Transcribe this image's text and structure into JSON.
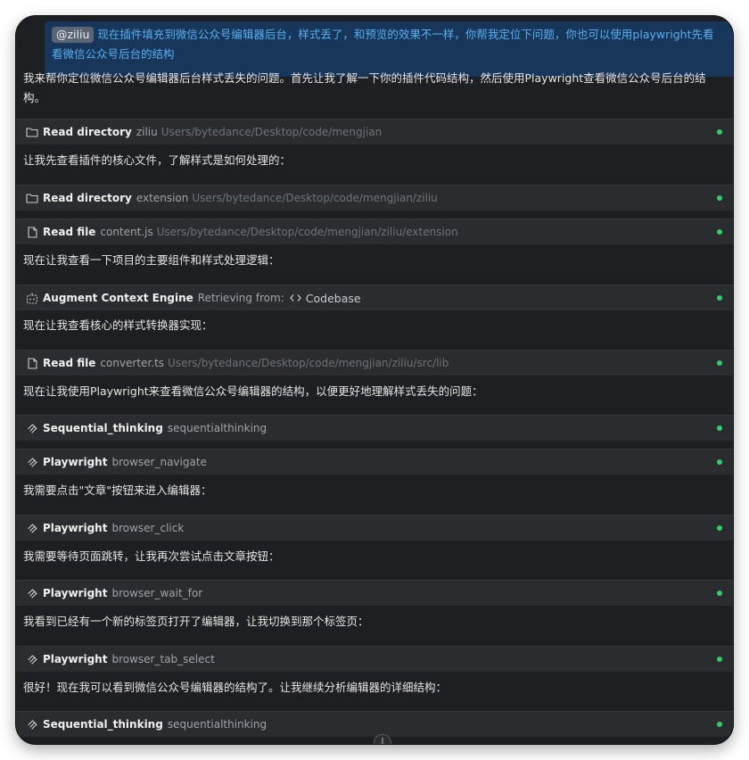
{
  "user_message": {
    "mention": "@ziliu",
    "text": "现在插件填充到微信公众号编辑器后台，样式丢了，和预览的效果不一样，你帮我定位下问题，你也可以使用playwright先看看微信公众号后台的结构"
  },
  "messages": [
    "我来帮你定位微信公众号编辑器后台样式丢失的问题。首先让我了解一下你的插件代码结构，然后使用Playwright查看微信公众号后台的结构。",
    "让我先查看插件的核心文件，了解样式是如何处理的：",
    "现在让我查看一下项目的主要组件和样式处理逻辑：",
    "现在让我查看核心的样式转换器实现：",
    "现在让我使用Playwright来查看微信公众号编辑器的结构，以便更好地理解样式丢失的问题：",
    "我需要点击\"文章\"按钮来进入编辑器：",
    "我需要等待页面跳转，让我再次尝试点击文章按钮：",
    "我看到已经有一个新的标签页打开了编辑器，让我切换到那个标签页：",
    "很好！现在我可以看到微信公众号编辑器的结构了。让我继续分析编辑器的详细结构："
  ],
  "tools": [
    {
      "icon": "folder-icon",
      "name": "Read directory",
      "arg": "ziliu",
      "path": "Users/bytedance/Desktop/code/mengjian"
    },
    {
      "icon": "folder-icon",
      "name": "Read directory",
      "arg": "extension",
      "path": "Users/bytedance/Desktop/code/mengjian/ziliu"
    },
    {
      "icon": "file-icon",
      "name": "Read file",
      "arg": "content.js",
      "path": "Users/bytedance/Desktop/code/mengjian/ziliu/extension"
    },
    {
      "icon": "robot-icon",
      "name": "Augment Context Engine",
      "arg": "Retrieving from:",
      "path": "",
      "extra": "Codebase"
    },
    {
      "icon": "file-icon",
      "name": "Read file",
      "arg": "converter.ts",
      "path": "Users/bytedance/Desktop/code/mengjian/ziliu/src/lib"
    },
    {
      "icon": "mcp-icon",
      "name": "Sequential_thinking",
      "arg": "sequentialthinking",
      "path": ""
    },
    {
      "icon": "mcp-icon",
      "name": "Playwright",
      "arg": "browser_navigate",
      "path": ""
    },
    {
      "icon": "mcp-icon",
      "name": "Playwright",
      "arg": "browser_click",
      "path": ""
    },
    {
      "icon": "mcp-icon",
      "name": "Playwright",
      "arg": "browser_wait_for",
      "path": ""
    },
    {
      "icon": "mcp-icon",
      "name": "Playwright",
      "arg": "browser_tab_select",
      "path": ""
    },
    {
      "icon": "mcp-icon",
      "name": "Sequential_thinking",
      "arg": "sequentialthinking",
      "path": ""
    }
  ],
  "colors": {
    "background": "#1e1f22",
    "tool_bar": "#2a2c30",
    "user_bubble": "#18365a",
    "user_text": "#56b0f2",
    "status_success": "#2ecf6a"
  },
  "scroll_icon": "scroll-down-icon"
}
